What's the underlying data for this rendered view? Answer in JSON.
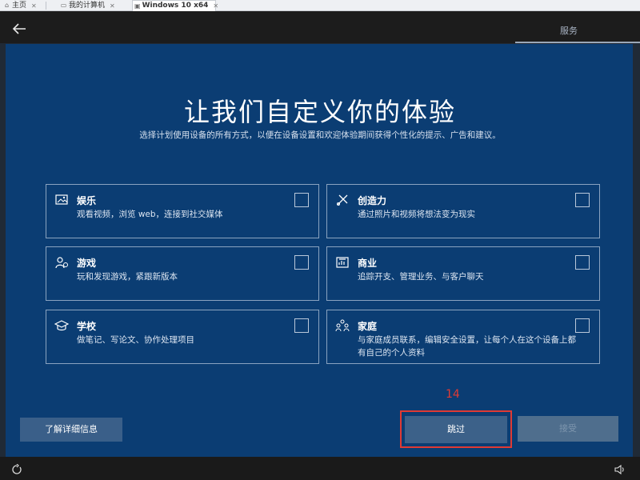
{
  "vm_tabs": [
    {
      "label": "主页"
    },
    {
      "label": "我的计算机"
    },
    {
      "label": "Windows 10 x64"
    }
  ],
  "stage_label": "服务",
  "title": "让我们自定义你的体验",
  "subtitle": "选择计划使用设备的所有方式，以便在设备设置和欢迎体验期间获得个性化的提示、广告和建议。",
  "cards": [
    {
      "name": "娱乐",
      "desc": "观看视频，浏览 web，连接到社交媒体",
      "icon": "entertainment-icon",
      "checked": false
    },
    {
      "name": "创造力",
      "desc": "通过照片和视频将想法变为现实",
      "icon": "creativity-icon",
      "checked": false
    },
    {
      "name": "游戏",
      "desc": "玩和发现游戏，紧跟新版本",
      "icon": "gaming-icon",
      "checked": false
    },
    {
      "name": "商业",
      "desc": "追踪开支、管理业务、与客户聊天",
      "icon": "business-icon",
      "checked": false
    },
    {
      "name": "学校",
      "desc": "做笔记、写论文、协作处理项目",
      "icon": "school-icon",
      "checked": false
    },
    {
      "name": "家庭",
      "desc": "与家庭成员联系，编辑安全设置，让每个人在这个设备上都有自己的个人资料",
      "icon": "family-icon",
      "checked": false
    }
  ],
  "buttons": {
    "learn_more": "了解详细信息",
    "skip": "跳过",
    "accept": "接受"
  },
  "annotation": "14",
  "colors": {
    "background": "#0b3d73",
    "highlight": "#e03a34"
  }
}
